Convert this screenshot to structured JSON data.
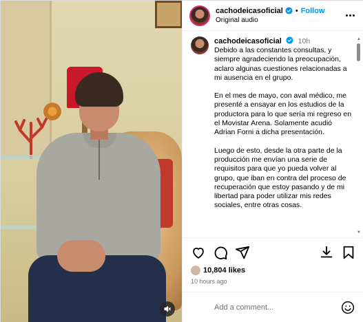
{
  "post": {
    "username": "cachodeicasoficial",
    "follow_label": "Follow",
    "audio_label": "Original audio",
    "time_ago_short": "10h",
    "paragraphs": [
      "Debido a las constantes consultas, y siempre agradeciendo la preocupación, aclaro algunas cuestiones relacionadas a mi ausencia en el grupo.",
      "En el mes de mayo, con aval médico, me presenté a ensayar en los estudios de la productora para lo que sería mi regreso en el Movistar Arena. Solamente acudió Adrian Forni a dicha presentación.",
      "Luego de esto, desde la otra parte de la producción me envían una serie de requisitos para que yo pueda volver al grupo, que iban en contra del proceso de recuperación que estoy pasando y de mi libertad para poder utilizar mis redes sociales, entre otras cosas."
    ],
    "likes": "10,804 likes",
    "time_ago_long": "10 hours ago",
    "comment_placeholder": "Add a comment..."
  },
  "icons": {
    "verified": "verified-badge-icon",
    "more": "more-options-icon",
    "like": "heart-icon",
    "comment": "comment-icon",
    "share": "share-icon",
    "save": "bookmark-icon",
    "download": "download-icon",
    "mute": "speaker-muted-icon",
    "emoji": "emoji-icon"
  },
  "colors": {
    "link_blue": "#0095f6",
    "muted_text": "#737373",
    "verified_blue": "#0095f6"
  }
}
